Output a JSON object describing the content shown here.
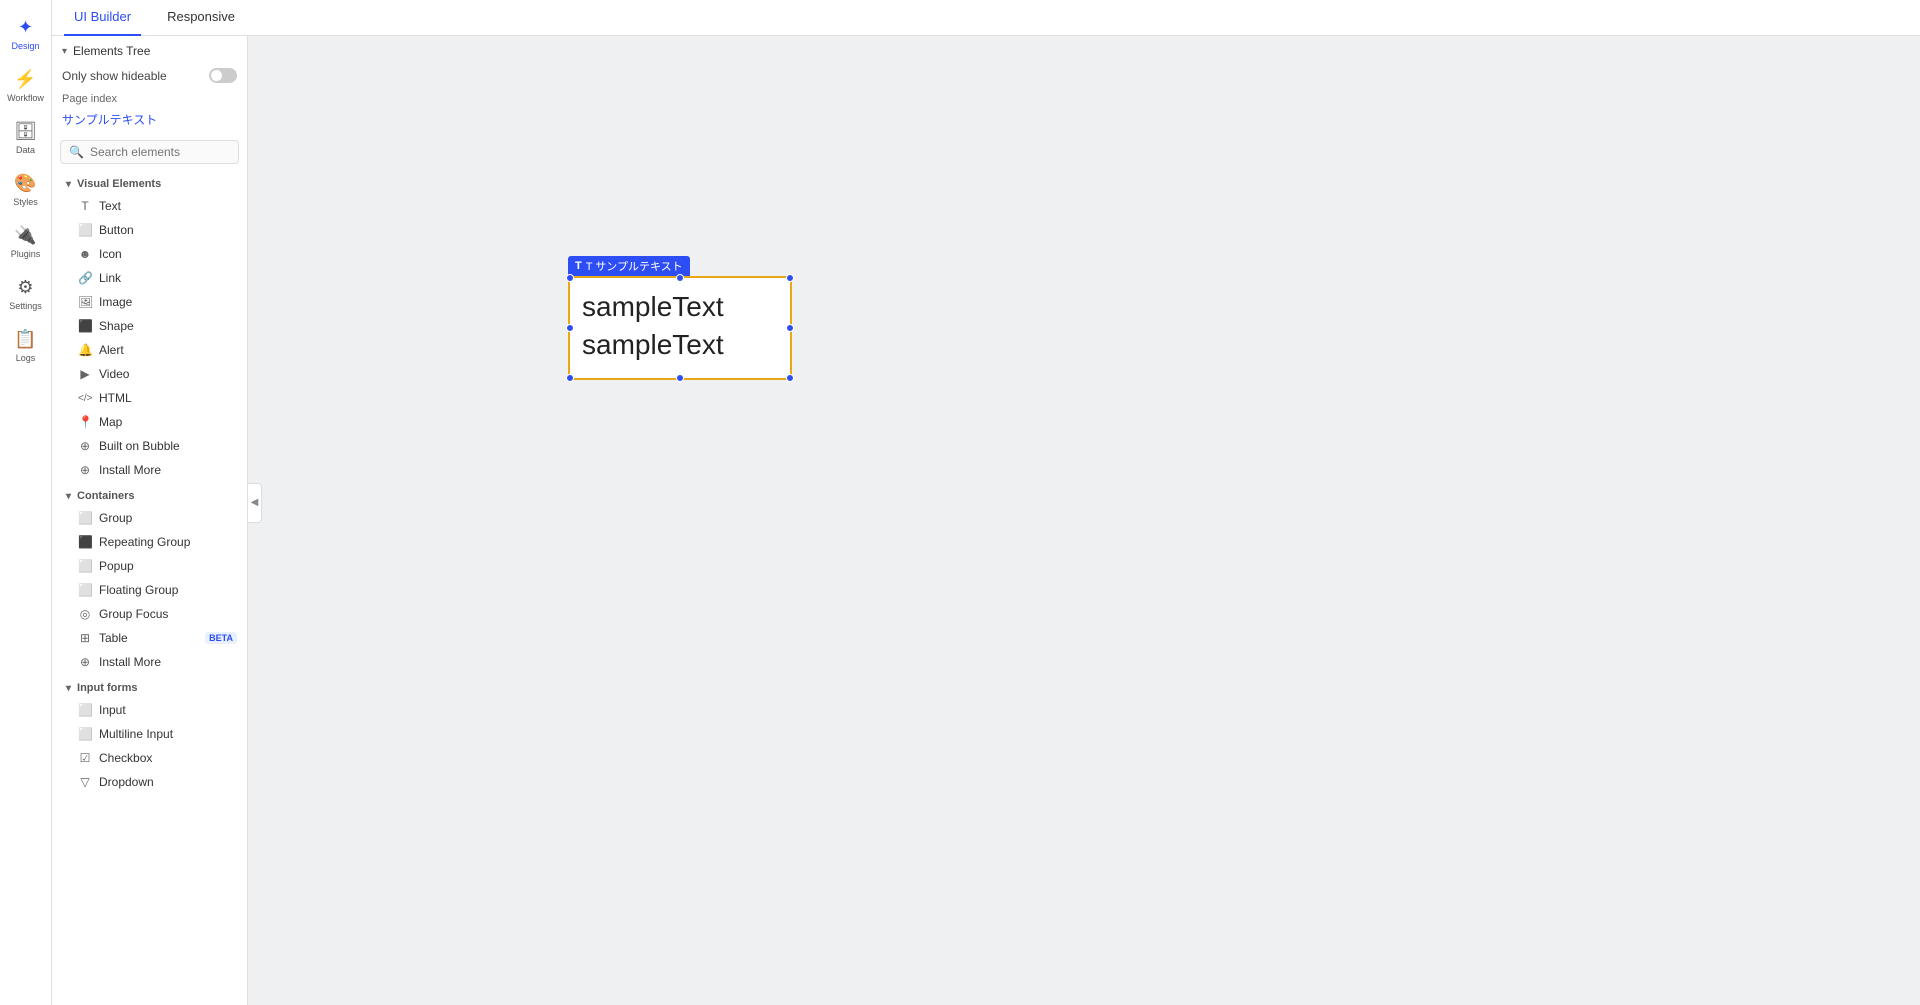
{
  "header": {
    "tabs": [
      {
        "id": "ui-builder",
        "label": "UI Builder",
        "active": true
      },
      {
        "id": "responsive",
        "label": "Responsive",
        "active": false
      }
    ]
  },
  "nav": {
    "items": [
      {
        "id": "design",
        "label": "Design",
        "icon": "✦",
        "active": true
      },
      {
        "id": "workflow",
        "label": "Workflow",
        "icon": "⚡",
        "active": false
      },
      {
        "id": "data",
        "label": "Data",
        "icon": "🗄",
        "active": false
      },
      {
        "id": "styles",
        "label": "Styles",
        "icon": "🎨",
        "active": false
      },
      {
        "id": "plugins",
        "label": "Plugins",
        "icon": "🔌",
        "active": false
      },
      {
        "id": "settings",
        "label": "Settings",
        "icon": "⚙",
        "active": false
      },
      {
        "id": "logs",
        "label": "Logs",
        "icon": "📋",
        "active": false
      }
    ]
  },
  "sidebar": {
    "elements_tree_label": "Elements Tree",
    "only_show_hideable": "Only show hideable",
    "page_index_label": "Page index",
    "page_name": "サンプルテキスト",
    "search_placeholder": "Search elements",
    "visual_elements": {
      "label": "Visual Elements",
      "items": [
        {
          "id": "text",
          "label": "Text",
          "icon": "T"
        },
        {
          "id": "button",
          "label": "Button",
          "icon": "⬜"
        },
        {
          "id": "icon",
          "label": "Icon",
          "icon": "☻"
        },
        {
          "id": "link",
          "label": "Link",
          "icon": "🔗"
        },
        {
          "id": "image",
          "label": "Image",
          "icon": "🖼"
        },
        {
          "id": "shape",
          "label": "Shape",
          "icon": "⬛"
        },
        {
          "id": "alert",
          "label": "Alert",
          "icon": "🔔"
        },
        {
          "id": "video",
          "label": "Video",
          "icon": "▶"
        },
        {
          "id": "html",
          "label": "HTML",
          "icon": "</>"
        },
        {
          "id": "map",
          "label": "Map",
          "icon": "📍"
        },
        {
          "id": "built-on-bubble",
          "label": "Built on Bubble",
          "icon": "⊕"
        },
        {
          "id": "install-more-visual",
          "label": "Install More",
          "icon": "⊕"
        }
      ]
    },
    "containers": {
      "label": "Containers",
      "items": [
        {
          "id": "group",
          "label": "Group",
          "icon": "⬜"
        },
        {
          "id": "repeating-group",
          "label": "Repeating Group",
          "icon": "⬛"
        },
        {
          "id": "popup",
          "label": "Popup",
          "icon": "⬜"
        },
        {
          "id": "floating-group",
          "label": "Floating Group",
          "icon": "⬜"
        },
        {
          "id": "group-focus",
          "label": "Group Focus",
          "icon": "◎"
        },
        {
          "id": "table",
          "label": "Table",
          "icon": "⊞",
          "beta": true
        },
        {
          "id": "install-more-containers",
          "label": "Install More",
          "icon": "⊕"
        }
      ]
    },
    "input_forms": {
      "label": "Input forms",
      "items": [
        {
          "id": "input",
          "label": "Input",
          "icon": "⬜"
        },
        {
          "id": "multiline-input",
          "label": "Multiline Input",
          "icon": "⬜"
        },
        {
          "id": "checkbox",
          "label": "Checkbox",
          "icon": "☑"
        },
        {
          "id": "dropdown",
          "label": "Dropdown",
          "icon": "▽"
        }
      ]
    }
  },
  "canvas": {
    "element_tag": "T サンプルテキスト",
    "sample_text_line1": "sampleText",
    "sample_text_line2": "sampleText"
  },
  "colors": {
    "accent_blue": "#2d4ef5",
    "orange_border": "#e6a817"
  }
}
